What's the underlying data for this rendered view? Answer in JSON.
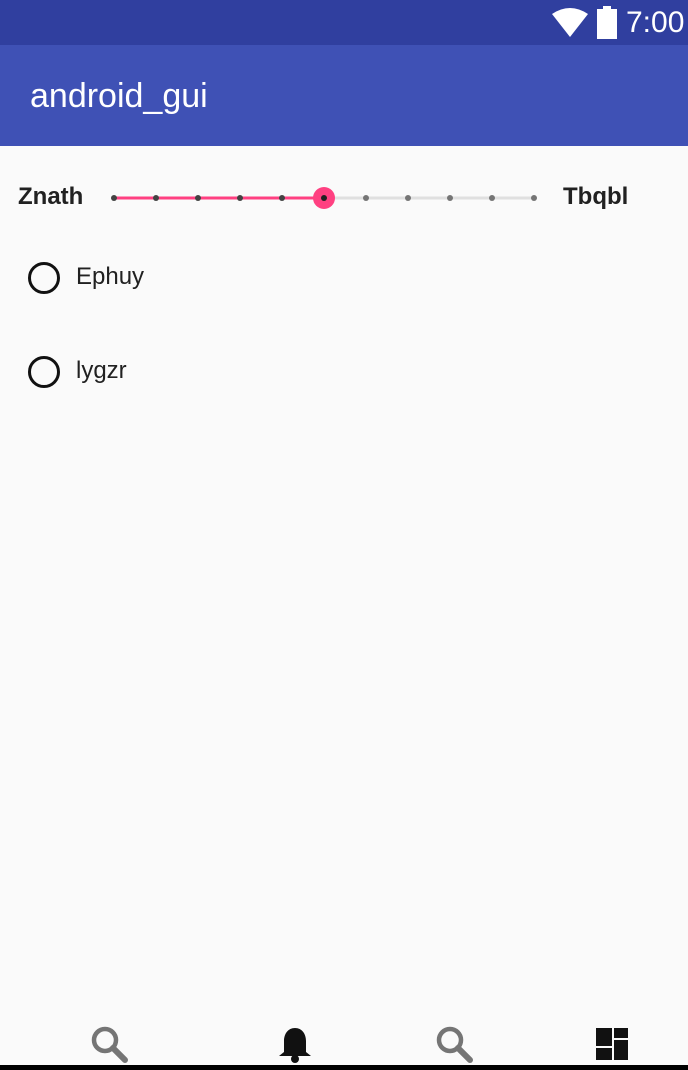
{
  "status_bar": {
    "time": "7:00",
    "wifi_icon": "wifi-icon",
    "battery_icon": "battery-icon"
  },
  "app_bar": {
    "title": "android_gui"
  },
  "slider": {
    "min_label": "Znath",
    "max_label": "Tbqbl",
    "steps": 10,
    "value": 5,
    "accent_color": "#ff4081"
  },
  "radio_group": {
    "options": [
      {
        "label": "Ephuy",
        "checked": false
      },
      {
        "label": "lygzr",
        "checked": false
      }
    ]
  },
  "bottom_nav": {
    "items": [
      {
        "icon": "search-icon"
      },
      {
        "icon": "bell-icon"
      },
      {
        "icon": "search-icon"
      },
      {
        "icon": "dashboard-icon"
      }
    ]
  },
  "colors": {
    "status_bar": "#303f9f",
    "app_bar": "#3f51b5",
    "background": "#fafafa"
  }
}
